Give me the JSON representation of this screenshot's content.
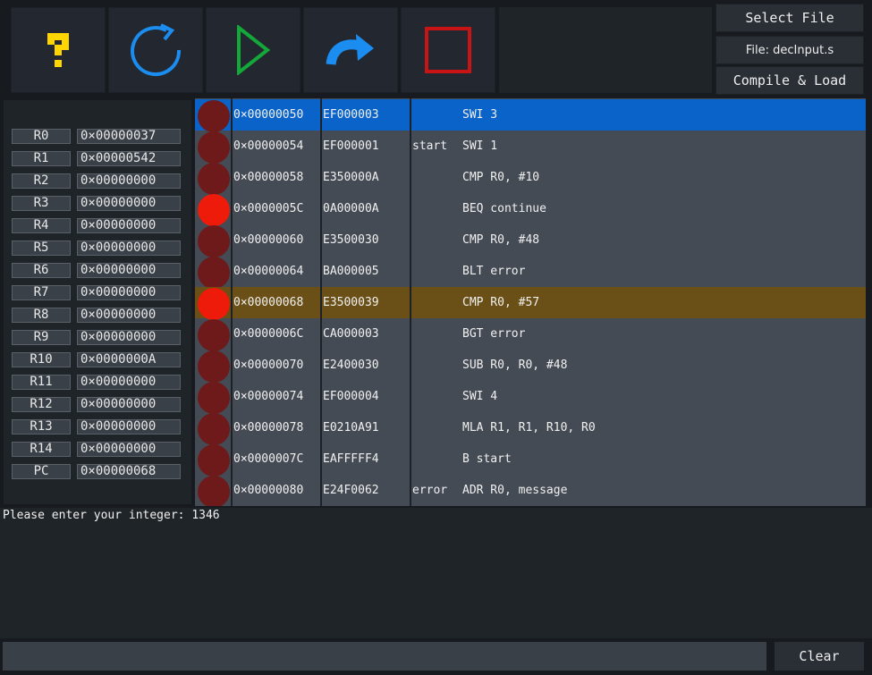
{
  "toolbar": {
    "help_icon": "help-icon",
    "reload_icon": "reload-icon",
    "run_icon": "play-icon",
    "step_icon": "step-over-icon",
    "stop_icon": "stop-icon"
  },
  "file": {
    "select_label": "Select File",
    "current_file": "File: decInput.s",
    "compile_label": "Compile & Load"
  },
  "registers": [
    {
      "name": "R0",
      "value": "0×00000037"
    },
    {
      "name": "R1",
      "value": "0×00000542"
    },
    {
      "name": "R2",
      "value": "0×00000000"
    },
    {
      "name": "R3",
      "value": "0×00000000"
    },
    {
      "name": "R4",
      "value": "0×00000000"
    },
    {
      "name": "R5",
      "value": "0×00000000"
    },
    {
      "name": "R6",
      "value": "0×00000000"
    },
    {
      "name": "R7",
      "value": "0×00000000"
    },
    {
      "name": "R8",
      "value": "0×00000000"
    },
    {
      "name": "R9",
      "value": "0×00000000"
    },
    {
      "name": "R10",
      "value": "0×0000000A"
    },
    {
      "name": "R11",
      "value": "0×00000000"
    },
    {
      "name": "R12",
      "value": "0×00000000"
    },
    {
      "name": "R13",
      "value": "0×00000000"
    },
    {
      "name": "R14",
      "value": "0×00000000"
    },
    {
      "name": "PC",
      "value": "0×00000068"
    }
  ],
  "code": [
    {
      "address": "0×00000050",
      "opcode": "EF000003",
      "label": "",
      "instruction": "SWI 3",
      "breakpoint": false,
      "state": "selected"
    },
    {
      "address": "0×00000054",
      "opcode": "EF000001",
      "label": "start",
      "instruction": "SWI 1",
      "breakpoint": false,
      "state": ""
    },
    {
      "address": "0×00000058",
      "opcode": "E350000A",
      "label": "",
      "instruction": "CMP R0, #10",
      "breakpoint": false,
      "state": ""
    },
    {
      "address": "0×0000005C",
      "opcode": "0A00000A",
      "label": "",
      "instruction": "BEQ continue",
      "breakpoint": true,
      "state": ""
    },
    {
      "address": "0×00000060",
      "opcode": "E3500030",
      "label": "",
      "instruction": "CMP R0, #48",
      "breakpoint": false,
      "state": ""
    },
    {
      "address": "0×00000064",
      "opcode": "BA000005",
      "label": "",
      "instruction": "BLT error",
      "breakpoint": false,
      "state": ""
    },
    {
      "address": "0×00000068",
      "opcode": "E3500039",
      "label": "",
      "instruction": "CMP R0, #57",
      "breakpoint": true,
      "state": "current"
    },
    {
      "address": "0×0000006C",
      "opcode": "CA000003",
      "label": "",
      "instruction": "BGT error",
      "breakpoint": false,
      "state": ""
    },
    {
      "address": "0×00000070",
      "opcode": "E2400030",
      "label": "",
      "instruction": "SUB R0, R0, #48",
      "breakpoint": false,
      "state": ""
    },
    {
      "address": "0×00000074",
      "opcode": "EF000004",
      "label": "",
      "instruction": "SWI 4",
      "breakpoint": false,
      "state": ""
    },
    {
      "address": "0×00000078",
      "opcode": "E0210A91",
      "label": "",
      "instruction": "MLA R1, R1, R10, R0",
      "breakpoint": false,
      "state": ""
    },
    {
      "address": "0×0000007C",
      "opcode": "EAFFFFF4",
      "label": "",
      "instruction": "B start",
      "breakpoint": false,
      "state": ""
    },
    {
      "address": "0×00000080",
      "opcode": "E24F0062",
      "label": "error",
      "instruction": "ADR R0, message",
      "breakpoint": false,
      "state": ""
    }
  ],
  "console": {
    "output": "Please enter your integer: 1346",
    "input_value": "",
    "clear_label": "Clear"
  },
  "colors": {
    "selected_row": "#0a63c9",
    "current_row": "#6a5016",
    "breakpoint_on": "#ee1a0a",
    "breakpoint_off": "#6e1a1a"
  }
}
